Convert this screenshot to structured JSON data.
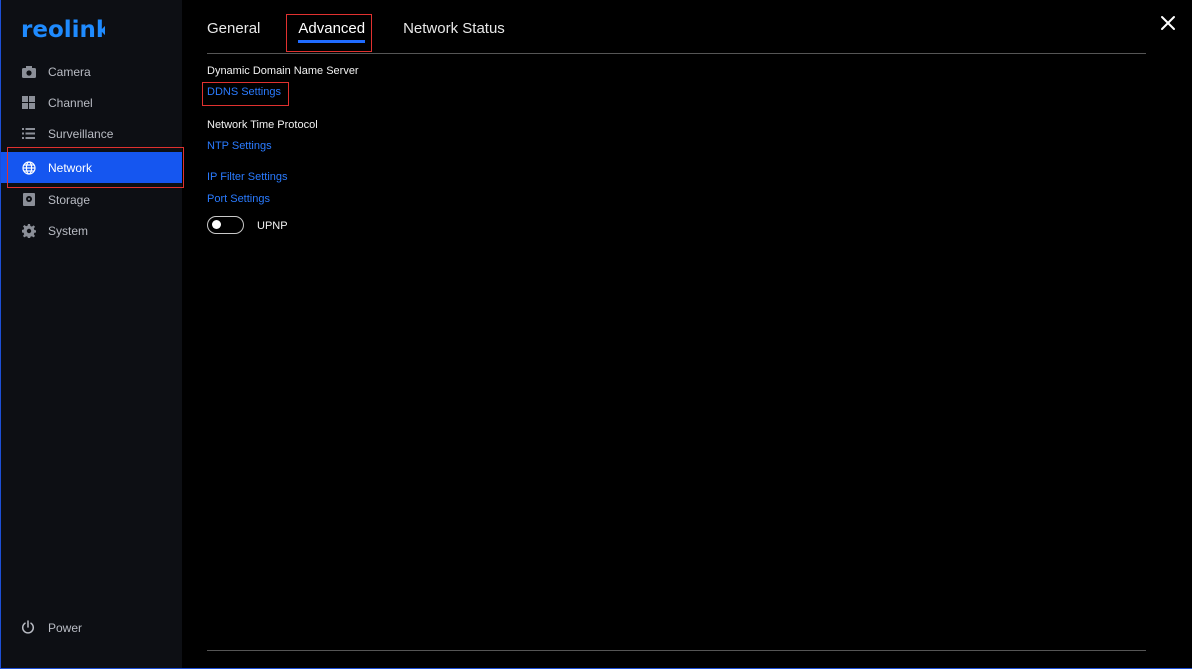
{
  "app": {
    "logo_text": "reolink",
    "brand_color": "#1f6bff"
  },
  "sidebar": {
    "items": [
      {
        "label": "Camera",
        "icon": "camera-icon"
      },
      {
        "label": "Channel",
        "icon": "grid-icon"
      },
      {
        "label": "Surveillance",
        "icon": "list-icon"
      },
      {
        "label": "Network",
        "icon": "globe-icon",
        "active": true
      },
      {
        "label": "Storage",
        "icon": "storage-icon"
      },
      {
        "label": "System",
        "icon": "gear-icon"
      }
    ],
    "power_label": "Power"
  },
  "tabs": [
    {
      "label": "General"
    },
    {
      "label": "Advanced",
      "active": true
    },
    {
      "label": "Network Status"
    }
  ],
  "content": {
    "ddns_section_title": "Dynamic Domain Name Server",
    "ddns_link": "DDNS Settings",
    "ntp_section_title": "Network Time Protocol",
    "ntp_link": "NTP Settings",
    "ip_filter_link": "IP Filter Settings",
    "port_link": "Port Settings",
    "upnp_label": "UPNP",
    "upnp_enabled": false
  },
  "colors": {
    "accent": "#1556f0",
    "link": "#2a7bff",
    "highlight_box": "#e0312f"
  }
}
